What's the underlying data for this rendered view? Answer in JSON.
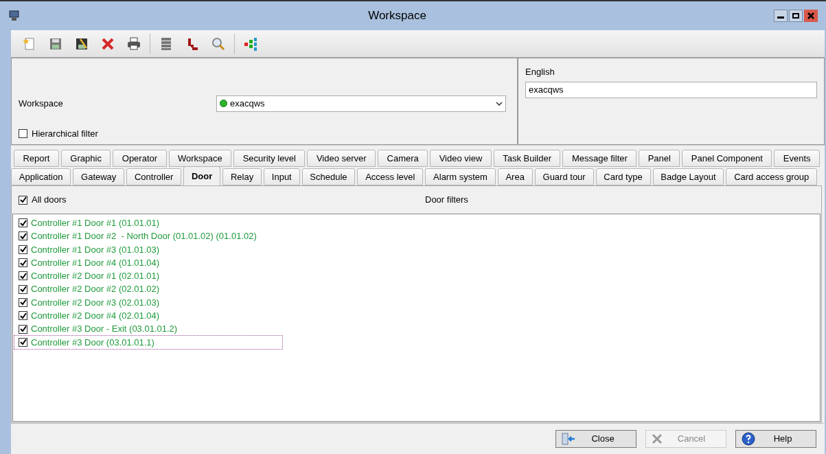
{
  "window": {
    "title": "Workspace"
  },
  "form": {
    "workspace_label": "Workspace",
    "workspace_value": "exacqws",
    "hierarchical_filter": {
      "label": "Hierarchical filter",
      "checked": false
    },
    "language_label": "English",
    "language_value": "exacqws"
  },
  "tabs_back": [
    {
      "label": "Report",
      "selected": false
    },
    {
      "label": "Graphic",
      "selected": false
    },
    {
      "label": "Operator",
      "selected": false
    },
    {
      "label": "Workspace",
      "selected": false
    },
    {
      "label": "Security level",
      "selected": false
    },
    {
      "label": "Video server",
      "selected": false
    },
    {
      "label": "Camera",
      "selected": false
    },
    {
      "label": "Video view",
      "selected": false
    },
    {
      "label": "Task Builder",
      "selected": false
    },
    {
      "label": "Message filter",
      "selected": false
    },
    {
      "label": "Panel",
      "selected": false
    },
    {
      "label": "Panel Component",
      "selected": false
    },
    {
      "label": "Events",
      "selected": false
    }
  ],
  "tabs_front": [
    {
      "label": "Application",
      "selected": false
    },
    {
      "label": "Gateway",
      "selected": false
    },
    {
      "label": "Controller",
      "selected": false
    },
    {
      "label": "Door",
      "selected": true
    },
    {
      "label": "Relay",
      "selected": false
    },
    {
      "label": "Input",
      "selected": false
    },
    {
      "label": "Schedule",
      "selected": false
    },
    {
      "label": "Access level",
      "selected": false
    },
    {
      "label": "Alarm system",
      "selected": false
    },
    {
      "label": "Area",
      "selected": false
    },
    {
      "label": "Guard tour",
      "selected": false
    },
    {
      "label": "Card type",
      "selected": false
    },
    {
      "label": "Badge Layout",
      "selected": false
    },
    {
      "label": "Card access group",
      "selected": false
    }
  ],
  "door_panel": {
    "all_doors": {
      "label": "All doors",
      "checked": true
    },
    "filters_title": "Door filters"
  },
  "doors": [
    {
      "label": "Controller #1 Door #1 (01.01.01)",
      "checked": true,
      "focused": false
    },
    {
      "label": "Controller #1 Door #2  - North Door (01.01.02) (01.01.02)",
      "checked": true,
      "focused": false
    },
    {
      "label": "Controller #1 Door #3 (01.01.03)",
      "checked": true,
      "focused": false
    },
    {
      "label": "Controller #1 Door #4 (01.01.04)",
      "checked": true,
      "focused": false
    },
    {
      "label": "Controller #2 Door #1 (02.01.01)",
      "checked": true,
      "focused": false
    },
    {
      "label": "Controller #2 Door #2 (02.01.02)",
      "checked": true,
      "focused": false
    },
    {
      "label": "Controller #2 Door #3 (02.01.03)",
      "checked": true,
      "focused": false
    },
    {
      "label": "Controller #2 Door #4 (02.01.04)",
      "checked": true,
      "focused": false
    },
    {
      "label": "Controller #3 Door - Exit (03.01.01.2)",
      "checked": true,
      "focused": false
    },
    {
      "label": "Controller #3 Door (03.01.01.1)",
      "checked": true,
      "focused": true
    }
  ],
  "buttons": [
    {
      "label": "Close",
      "kind": "close",
      "disabled": false
    },
    {
      "label": "Cancel",
      "kind": "cancel",
      "disabled": true
    },
    {
      "label": "Help",
      "kind": "help",
      "disabled": false
    }
  ]
}
